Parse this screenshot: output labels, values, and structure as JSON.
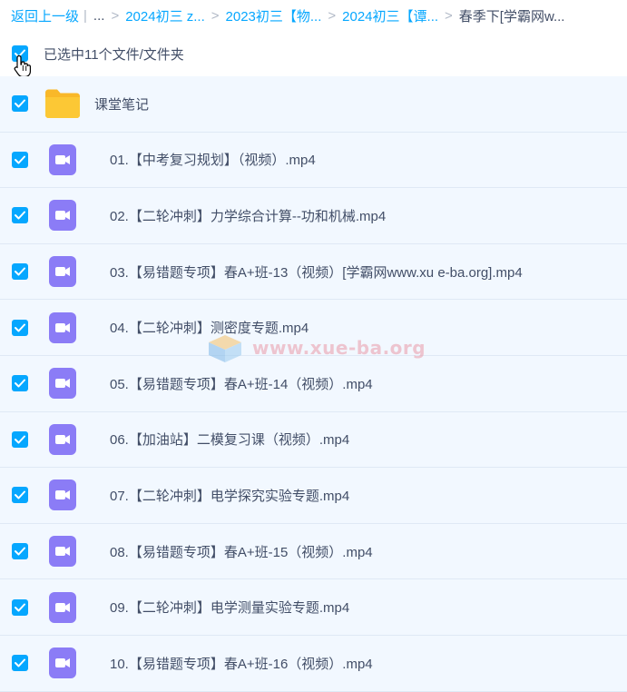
{
  "breadcrumb": {
    "back": "返回上一级",
    "sep": "|",
    "ellipsis": "...",
    "items": [
      "2024初三 z...",
      "2023初三【物...",
      "2024初三【谭..."
    ],
    "current": "春季下[学霸网w..."
  },
  "selection": {
    "text": "已选中11个文件/文件夹"
  },
  "files": [
    {
      "name": "课堂笔记",
      "type": "folder"
    },
    {
      "name": "01.【中考复习规划】（视频）.mp4",
      "type": "video"
    },
    {
      "name": "02.【二轮冲刺】力学综合计算--功和机械.mp4",
      "type": "video"
    },
    {
      "name": "03.【易错题专项】春A+班-13（视频）[学霸网www.xu e-ba.org].mp4",
      "type": "video"
    },
    {
      "name": "04.【二轮冲刺】测密度专题.mp4",
      "type": "video"
    },
    {
      "name": "05.【易错题专项】春A+班-14（视频）.mp4",
      "type": "video"
    },
    {
      "name": "06.【加油站】二模复习课（视频）.mp4",
      "type": "video"
    },
    {
      "name": "07.【二轮冲刺】电学探究实验专题.mp4",
      "type": "video"
    },
    {
      "name": "08.【易错题专项】春A+班-15（视频）.mp4",
      "type": "video"
    },
    {
      "name": "09.【二轮冲刺】电学测量实验专题.mp4",
      "type": "video"
    },
    {
      "name": "10.【易错题专项】春A+班-16（视频）.mp4",
      "type": "video"
    }
  ],
  "watermark": {
    "text": "www.xue-ba.org"
  },
  "colors": {
    "accent": "#06a7ff",
    "video_icon": "#8b7cf6",
    "folder": "#fcc432",
    "row_bg": "#f2f8ff"
  },
  "icons": {
    "checkbox": "checkbox-checked-icon",
    "folder": "folder-icon",
    "video": "video-file-icon",
    "cursor": "hand-pointer-icon"
  }
}
